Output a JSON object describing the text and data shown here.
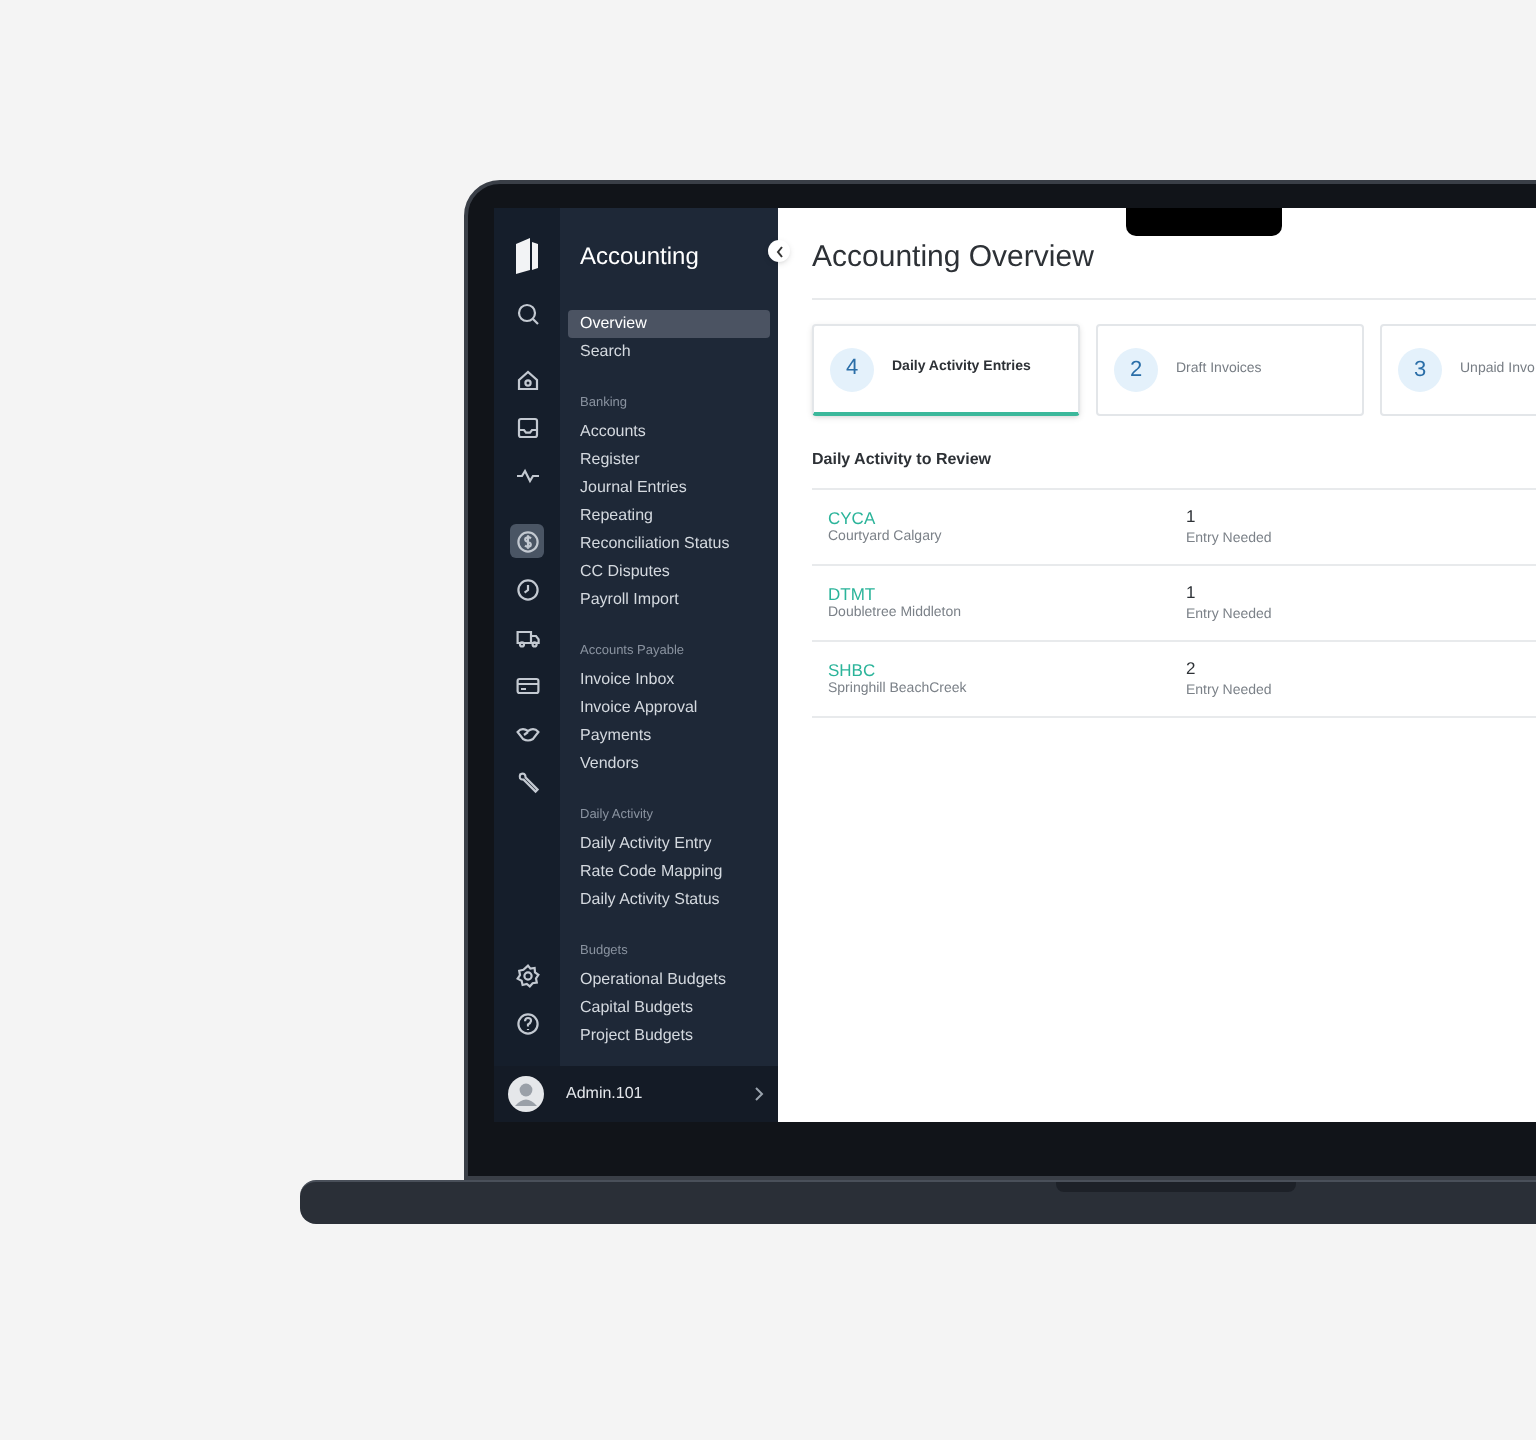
{
  "app": {
    "title": "Accounting"
  },
  "icon_rail": [
    {
      "selected": false
    },
    {
      "selected": false
    },
    {
      "selected": false
    },
    {
      "selected": false
    },
    {
      "selected": true
    },
    {
      "selected": false
    },
    {
      "selected": false
    },
    {
      "selected": false
    },
    {
      "selected": false
    },
    {
      "selected": false
    },
    {
      "selected": false
    },
    {
      "selected": false
    }
  ],
  "sidebar": {
    "sections": [
      {
        "items": [
          {
            "label": "Overview",
            "selected": true
          },
          {
            "label": "Search",
            "selected": false
          }
        ]
      },
      {
        "heading": "Banking",
        "items": [
          {
            "label": "Accounts",
            "selected": false
          },
          {
            "label": "Register",
            "selected": false
          },
          {
            "label": "Journal Entries",
            "selected": false
          },
          {
            "label": "Repeating",
            "selected": false
          },
          {
            "label": "Reconciliation Status",
            "selected": false
          },
          {
            "label": "CC Disputes",
            "selected": false
          },
          {
            "label": "Payroll Import",
            "selected": false
          }
        ]
      },
      {
        "heading": "Accounts Payable",
        "items": [
          {
            "label": "Invoice Inbox",
            "selected": false
          },
          {
            "label": "Invoice Approval",
            "selected": false
          },
          {
            "label": "Payments",
            "selected": false
          },
          {
            "label": "Vendors",
            "selected": false
          }
        ]
      },
      {
        "heading": "Daily Activity",
        "items": [
          {
            "label": "Daily Activity Entry",
            "selected": false
          },
          {
            "label": "Rate Code Mapping",
            "selected": false
          },
          {
            "label": "Daily Activity Status",
            "selected": false
          }
        ]
      },
      {
        "heading": "Budgets",
        "items": [
          {
            "label": "Operational Budgets",
            "selected": false
          },
          {
            "label": "Capital Budgets",
            "selected": false
          },
          {
            "label": "Project Budgets",
            "selected": false
          }
        ]
      }
    ]
  },
  "user": {
    "name": "Admin.101"
  },
  "main": {
    "title": "Accounting Overview",
    "cards": [
      {
        "count": "4",
        "label": "Daily Activity Entries",
        "selected": true
      },
      {
        "count": "2",
        "label": "Draft Invoices",
        "selected": false
      },
      {
        "count": "3",
        "label": "Unpaid Invo",
        "selected": false
      }
    ],
    "section_title": "Daily Activity to Review",
    "rows": [
      {
        "code": "CYCA",
        "name": "Courtyard Calgary",
        "count": "1",
        "status": "Entry Needed"
      },
      {
        "code": "DTMT",
        "name": "Doubletree Middleton",
        "count": "1",
        "status": "Entry Needed"
      },
      {
        "code": "SHBC",
        "name": "Springhill BeachCreek",
        "count": "2",
        "status": "Entry Needed"
      }
    ]
  }
}
